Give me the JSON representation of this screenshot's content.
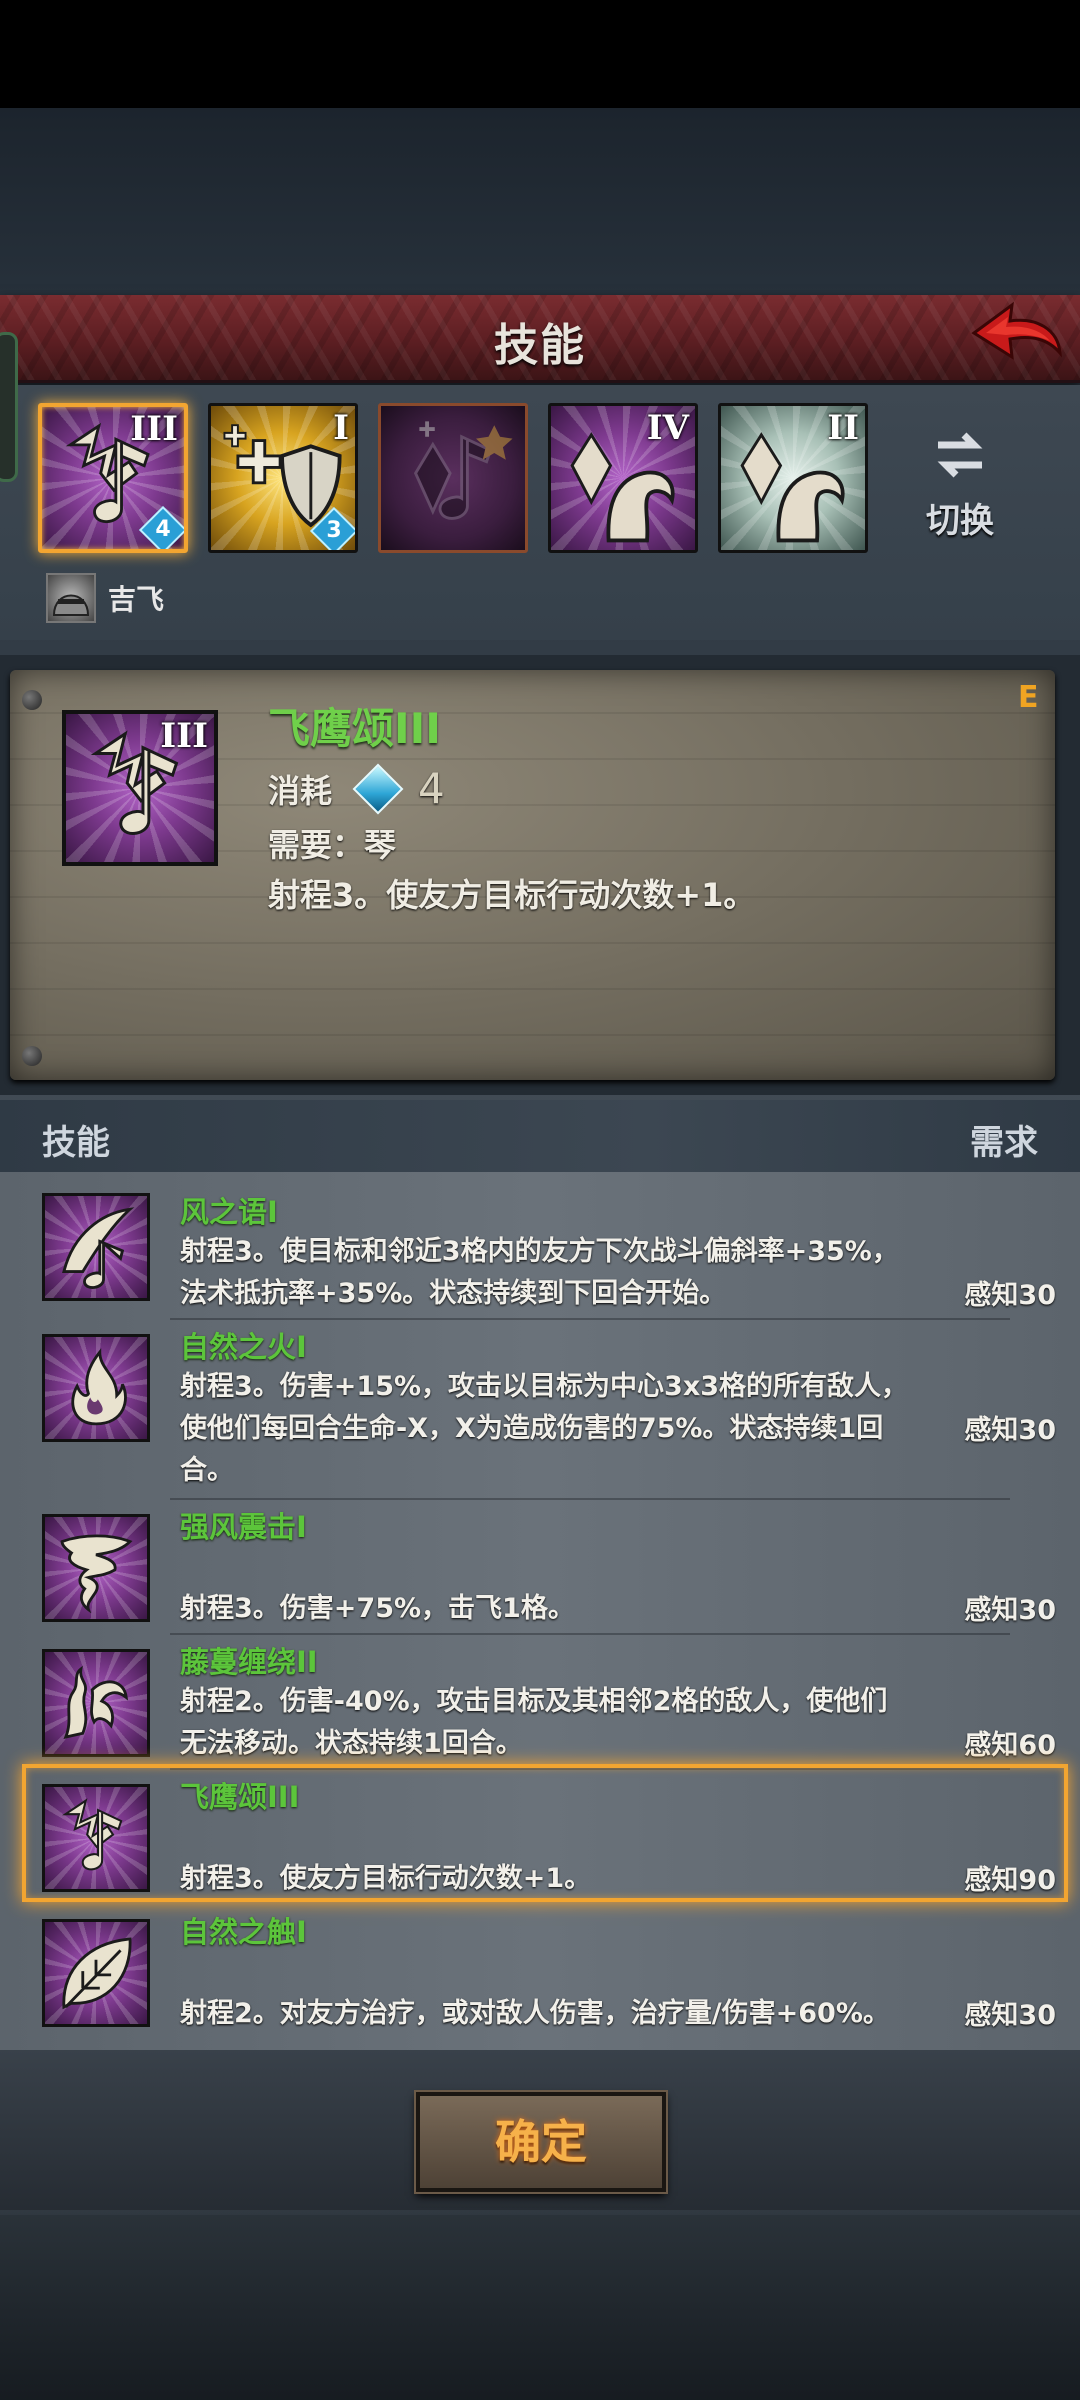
{
  "header": {
    "title": "技能"
  },
  "slots": [
    {
      "numeral": "III",
      "cost": "4",
      "style": "purple",
      "icon": "music-note-icon"
    },
    {
      "numeral": "I",
      "cost": "3",
      "style": "gold",
      "icon": "healing-shield-icon"
    },
    {
      "numeral": "",
      "cost": "",
      "style": "dark",
      "icon": "empty-slot-icon"
    },
    {
      "numeral": "IV",
      "cost": "",
      "style": "purple",
      "icon": "crystal-arm-icon"
    },
    {
      "numeral": "II",
      "cost": "",
      "style": "teal",
      "icon": "crystal-arm-icon"
    }
  ],
  "switch_label": "切换",
  "owner": {
    "name": "吉飞"
  },
  "detail": {
    "name": "飞鹰颂III",
    "numeral": "III",
    "cost_label": "消耗",
    "cost_value": "4",
    "requirement": "需要：琴",
    "description": "射程3。使友方目标行动次数+1。",
    "rank": "E"
  },
  "list": {
    "col_skill": "技能",
    "col_req": "需求",
    "items": [
      {
        "name": "风之语I",
        "desc": "射程3。使目标和邻近3格内的友方下次战斗偏斜率+35%，法术抵抗率+35%。状态持续到下回合开始。",
        "req": "感知30",
        "icon": "feather-note-icon"
      },
      {
        "name": "自然之火I",
        "desc": "射程3。伤害+15%，攻击以目标为中心3x3格的所有敌人，使他们每回合生命-X，X为造成伤害的75%。状态持续1回合。",
        "req": "感知30",
        "icon": "flame-icon"
      },
      {
        "name": "强风震击I",
        "desc": "射程3。伤害+75%，击飞1格。",
        "req": "感知30",
        "icon": "tornado-icon"
      },
      {
        "name": "藤蔓缠绕II",
        "desc": "射程2。伤害-40%，攻击目标及其相邻2格的敌人，使他们无法移动。状态持续1回合。",
        "req": "感知60",
        "icon": "vine-icon"
      },
      {
        "name": "飞鹰颂III",
        "desc": "射程3。使友方目标行动次数+1。",
        "req": "感知90",
        "icon": "music-note-icon"
      },
      {
        "name": "自然之触I",
        "desc": "射程2。对友方治疗，或对敌人伤害，治疗量/伤害+60%。",
        "req": "感知30",
        "icon": "leaf-icon"
      }
    ]
  },
  "confirm_label": "确定",
  "colors": {
    "accent": "#f2a531",
    "skill_name": "#5cc53b",
    "title_bar": "#7a2c30"
  }
}
